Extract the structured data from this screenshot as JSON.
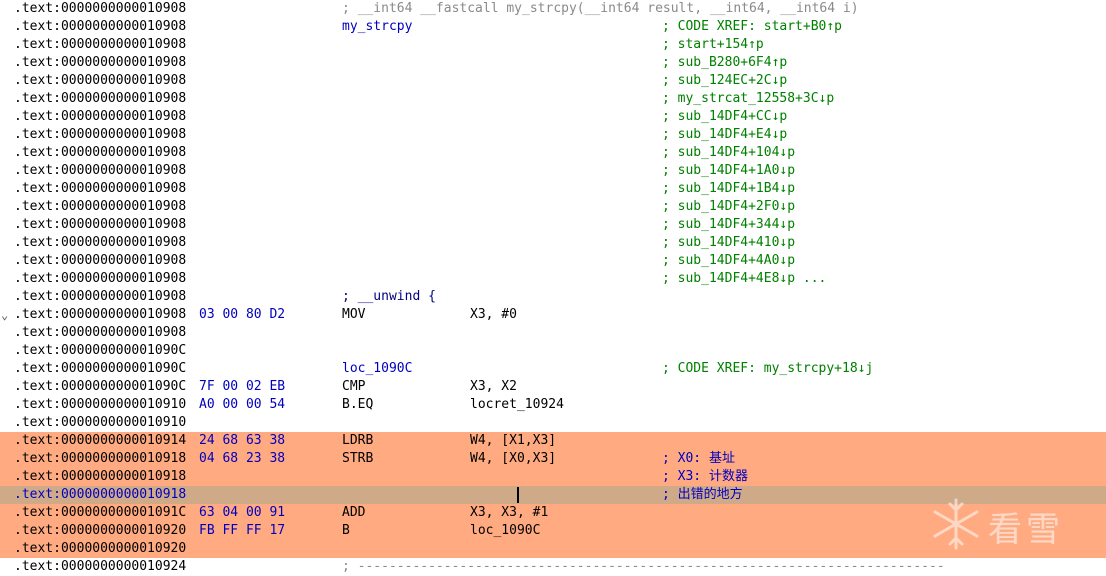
{
  "rows": [
    {
      "addr": ".text:0000000000010908",
      "c1": "; __int64 __fastcall my_strcpy(__int64 result, __int64, __int64 i)",
      "c1style": "gray"
    },
    {
      "addr": ".text:0000000000010908",
      "c1": "my_strcpy",
      "c1style": "blue",
      "cmt": "; CODE XREF: start+B0↑p"
    },
    {
      "addr": ".text:0000000000010908",
      "cmt": "; start+154↑p"
    },
    {
      "addr": ".text:0000000000010908",
      "cmt": "; sub_B280+6F4↑p"
    },
    {
      "addr": ".text:0000000000010908",
      "cmt": "; sub_124EC+2C↓p"
    },
    {
      "addr": ".text:0000000000010908",
      "cmt": "; my_strcat_12558+3C↓p"
    },
    {
      "addr": ".text:0000000000010908",
      "cmt": "; sub_14DF4+CC↓p"
    },
    {
      "addr": ".text:0000000000010908",
      "cmt": "; sub_14DF4+E4↓p"
    },
    {
      "addr": ".text:0000000000010908",
      "cmt": "; sub_14DF4+104↓p"
    },
    {
      "addr": ".text:0000000000010908",
      "cmt": "; sub_14DF4+1A0↓p"
    },
    {
      "addr": ".text:0000000000010908",
      "cmt": "; sub_14DF4+1B4↓p"
    },
    {
      "addr": ".text:0000000000010908",
      "cmt": "; sub_14DF4+2F0↓p"
    },
    {
      "addr": ".text:0000000000010908",
      "cmt": "; sub_14DF4+344↓p"
    },
    {
      "addr": ".text:0000000000010908",
      "cmt": "; sub_14DF4+410↓p"
    },
    {
      "addr": ".text:0000000000010908",
      "cmt": "; sub_14DF4+4A0↓p"
    },
    {
      "addr": ".text:0000000000010908",
      "cmt": "; sub_14DF4+4E8↓p ..."
    },
    {
      "addr": ".text:0000000000010908",
      "c1": "; __unwind {",
      "c1style": "navy"
    },
    {
      "addr": ".text:0000000000010908",
      "fold": "⌄",
      "bytes": "03 00 80 D2",
      "c1": "MOV",
      "c2": "X3, #0"
    },
    {
      "addr": ".text:0000000000010908"
    },
    {
      "addr": ".text:000000000001090C"
    },
    {
      "addr": ".text:000000000001090C",
      "c1": "loc_1090C",
      "c1style": "blue",
      "cmt": "; CODE XREF: my_strcpy+18↓j"
    },
    {
      "addr": ".text:000000000001090C",
      "bytes": "7F 00 02 EB",
      "c1": "CMP",
      "c2": "X3, X2"
    },
    {
      "addr": ".text:0000000000010910",
      "bytes": "A0 00 00 54",
      "c1": "B.EQ",
      "c2": "locret_10924"
    },
    {
      "addr": ".text:0000000000010910"
    },
    {
      "addr": ".text:0000000000010914",
      "bytes": "24 68 63 38",
      "c1": "LDRB",
      "c2": "W4, [X1,X3]",
      "hl": true
    },
    {
      "addr": ".text:0000000000010918",
      "bytes": "04 68 23 38",
      "c1": "STRB",
      "c2": "W4, [X0,X3]",
      "cmt": "; X0: 基址",
      "cmtstyle": "blue",
      "hl": true
    },
    {
      "addr": ".text:0000000000010918",
      "cmt": "; X3: 计数器",
      "cmtstyle": "blue",
      "hl": true
    },
    {
      "addr": ".text:0000000000010918",
      "cmt": "; 出错的地方",
      "cmtstyle": "blue",
      "cur": true
    },
    {
      "addr": ".text:000000000001091C",
      "bytes": "63 04 00 91",
      "c1": "ADD",
      "c2": "X3, X3, #1",
      "hl": true
    },
    {
      "addr": ".text:0000000000010920",
      "bytes": "FB FF FF 17",
      "c1": "B",
      "c2": "loc_1090C",
      "hl": true
    },
    {
      "addr": ".text:0000000000010920",
      "hl": true
    },
    {
      "addr": ".text:0000000000010924",
      "c1": "; ---------------------------------------------------------------------------",
      "c1style": "gray"
    }
  ],
  "watermark": {
    "text": "看雪",
    "icon": "snowflake-icon"
  }
}
